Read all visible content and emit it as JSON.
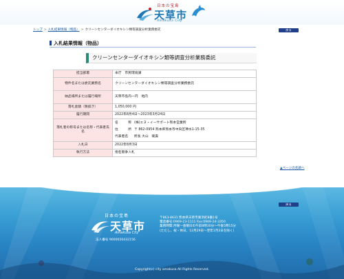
{
  "header": {
    "tagline": "日本の宝島",
    "city_name": "天草市",
    "city_romaji": "Amakusa City"
  },
  "breadcrumb": {
    "items": [
      "トップ",
      "入札結果情報（物品）",
      "クリーンセンターダイオキシン類等調査分析業務委託"
    ]
  },
  "back_label": "戻る",
  "section": {
    "title": "入札結果情報（物品）"
  },
  "item_title": "クリーンセンターダイオキシン類等調査分析業務委託",
  "table": {
    "rows": [
      {
        "label": "担当部署",
        "value": "本庁　市民環境課"
      },
      {
        "label": "物件名または委託業務名",
        "value": "クリーンセンターダイオキシン類等調査分析業務委託"
      },
      {
        "label": "納品場所または履行場所",
        "value": "天草市島内一円　地内"
      },
      {
        "label": "落札金額（税抜き）",
        "value": "1,050,000 円"
      },
      {
        "label": "履行期間",
        "value": "2022年8月4日～2023年3月24日"
      }
    ],
    "contractor": {
      "label": "落札者の称号または名称・代表者氏名",
      "name_key": "名　　　称",
      "name_value": "(株)エヌ・イーサポート熊本営業所",
      "addr_key": "住　　　所",
      "addr_value": "〒 862-0954 熊本県熊本市中央区神水1-15-35",
      "rep_key": "代表者名",
      "rep_value": "所長 大山　衛貴"
    },
    "rows2": [
      {
        "label": "入札日",
        "value": "2022年8月3日"
      },
      {
        "label": "執行方法",
        "value": "指名競争入札"
      }
    ]
  },
  "page_top": "▲ページの先頭へ",
  "footer": {
    "tagline": "日本の宝島",
    "city_name": "天草市",
    "city_romaji": "Amakusa City",
    "corp_no": "法人番号 9000020432156",
    "address_lines": [
      "〒863-8631 熊本県天草市東浜町8番1号",
      "電話番号:0969-23-1111 Fax:0969-24-3350",
      "業務時間:月曜～金曜日の午前8時30分～午後5時15分",
      "(ただし、祝・休日、12月29日～翌年1月3日を除く)"
    ],
    "copyright": "Copyright(c) city amakusa All Rights Reserved."
  }
}
